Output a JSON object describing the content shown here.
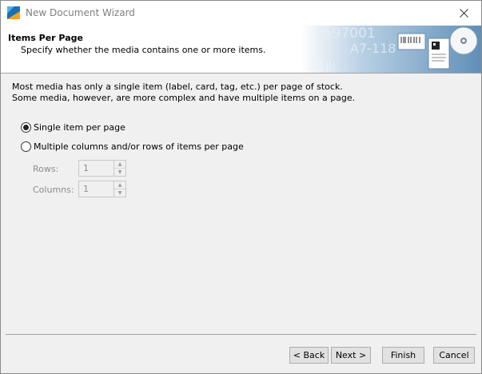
{
  "window": {
    "title": "New Document Wizard",
    "icons": {
      "app": "app-logo-icon",
      "close": "close-icon"
    }
  },
  "header": {
    "title": "Items Per Page",
    "subtitle": "Specify whether the media contains one or more items.",
    "banner_icon": "barcode-labels-banner-image",
    "banner_text": [
      "3597001",
      "A7-118"
    ]
  },
  "main": {
    "description": [
      "Most media has only a single item (label, card, tag, etc.) per page of stock.",
      "Some media, however, are more complex and have multiple items on a page."
    ],
    "options": [
      {
        "label": "Single item per page",
        "selected": true
      },
      {
        "label": "Multiple columns and/or rows of items per page",
        "selected": false
      }
    ],
    "rows": {
      "label": "Rows:",
      "value": "1"
    },
    "columns": {
      "label": "Columns:",
      "value": "1"
    }
  },
  "footer": {
    "back": "< Back",
    "next": "Next >",
    "finish": "Finish",
    "cancel": "Cancel"
  },
  "colors": {
    "disabled_text": "#8c8c8c",
    "button_bg": "#e1e1e1",
    "window_bg": "#f0f0f0"
  }
}
